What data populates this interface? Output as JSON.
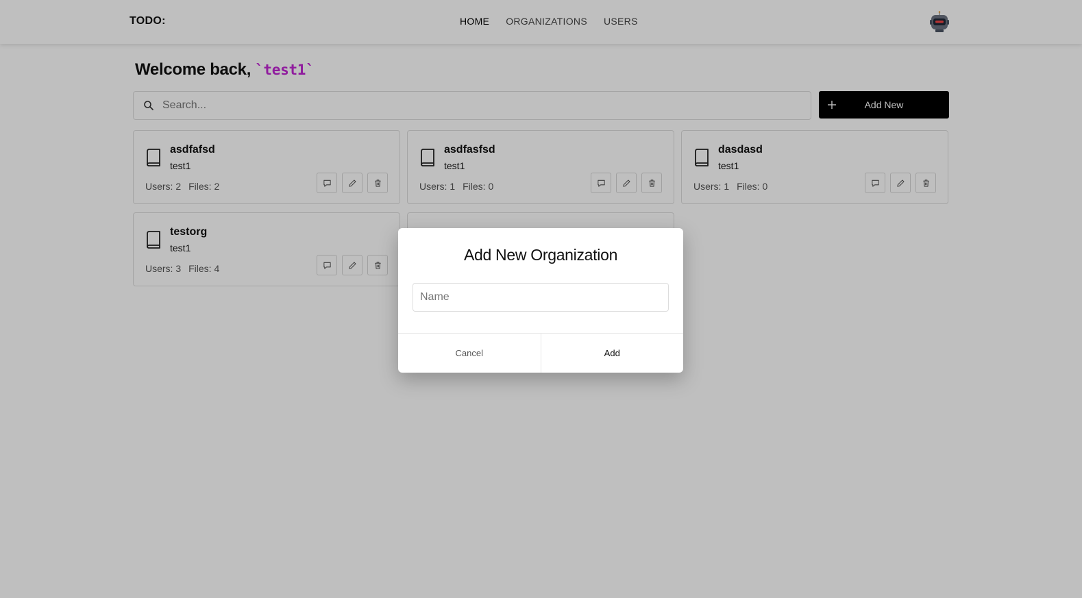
{
  "header": {
    "brand": "TODO:",
    "nav": [
      {
        "label": "HOME",
        "active": true
      },
      {
        "label": "ORGANIZATIONS",
        "active": false
      },
      {
        "label": "USERS",
        "active": false
      }
    ],
    "avatar_icon": "robot-avatar-icon"
  },
  "main": {
    "welcome_prefix": "Welcome back,",
    "username": "`test1`",
    "search_placeholder": "Search...",
    "add_new_label": "Add New"
  },
  "organizations": [
    {
      "name": "asdfafsd",
      "owner": "test1",
      "users": "Users: 2",
      "files": "Files: 2"
    },
    {
      "name": "asdfasfsd",
      "owner": "test1",
      "users": "Users: 1",
      "files": "Files: 0"
    },
    {
      "name": "dasdasd",
      "owner": "test1",
      "users": "Users: 1",
      "files": "Files: 0"
    },
    {
      "name": "testorg",
      "owner": "test1",
      "users": "Users: 3",
      "files": "Files: 4"
    }
  ],
  "modal": {
    "title": "Add New Organization",
    "name_placeholder": "Name",
    "name_value": "",
    "cancel_label": "Cancel",
    "add_label": "Add"
  },
  "colors": {
    "accent_username": "#c026d3",
    "primary_button": "#000000"
  }
}
